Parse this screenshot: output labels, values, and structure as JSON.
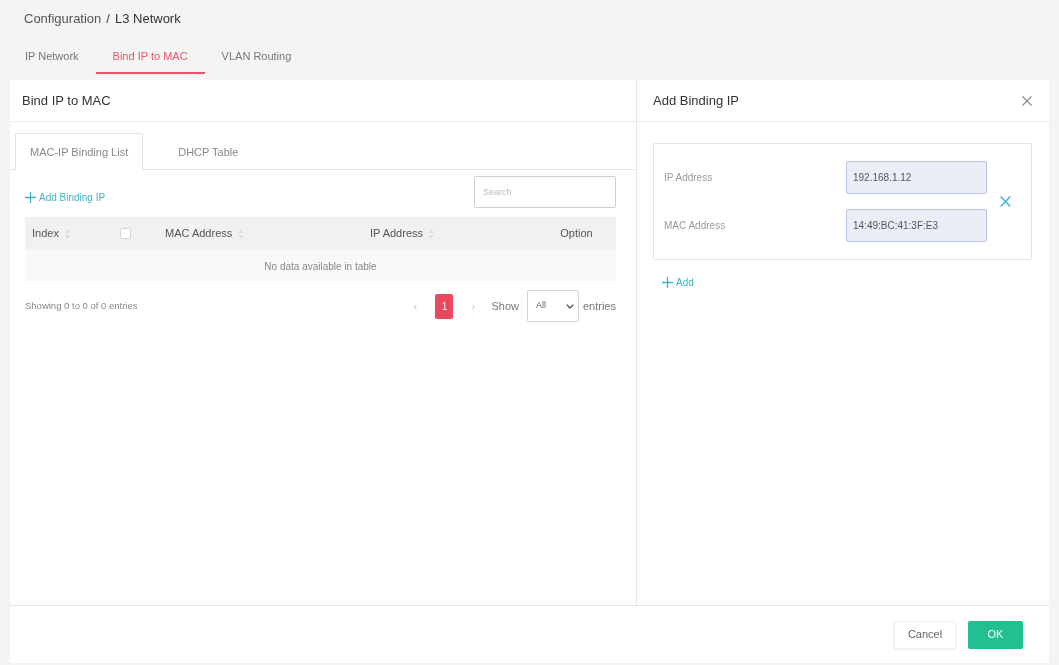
{
  "breadcrumb": {
    "items": [
      "Configuration",
      "L3 Network"
    ],
    "separator": "/"
  },
  "tabs": [
    {
      "label": "IP Network",
      "selected": false
    },
    {
      "label": "Bind IP to MAC",
      "selected": true
    },
    {
      "label": "VLAN Routing",
      "selected": false
    }
  ],
  "main_panel": {
    "title": "Bind IP to MAC",
    "sub_tabs": [
      {
        "label": "MAC-IP Binding List",
        "selected": true
      },
      {
        "label": "DHCP Table",
        "selected": false
      }
    ],
    "add_link": {
      "label": "Add Binding IP"
    },
    "search": {
      "placeholder": "Search"
    },
    "table": {
      "columns": [
        {
          "kind": "sortable",
          "label": "Index"
        },
        {
          "kind": "checkbox",
          "checked": false
        },
        {
          "kind": "sortable",
          "label": "MAC Address"
        },
        {
          "kind": "sortable",
          "label": "IP Address"
        },
        {
          "kind": "plain",
          "label": "Option"
        }
      ],
      "empty_message": "No data available in table"
    },
    "info": "Showing 0 to 0 of 0 entries",
    "pagination": {
      "previous": "‹",
      "pages": [
        {
          "label": "1",
          "selected": true
        }
      ],
      "next": "›"
    },
    "page_length": {
      "label_before": "Show",
      "value": "All",
      "label_after": "entries"
    }
  },
  "side_panel": {
    "title": "Add Binding IP",
    "entries": [
      {
        "fields": [
          {
            "label": "IP Address",
            "value": "192.168.1.12"
          },
          {
            "label": "MAC Address",
            "value": "14:49:BC:41:3F:E3"
          }
        ]
      }
    ],
    "add_link": {
      "label": "Add"
    }
  },
  "footer": {
    "buttons": [
      {
        "kind": "secondary",
        "label": "Cancel"
      },
      {
        "kind": "primary",
        "label": "OK"
      }
    ]
  }
}
